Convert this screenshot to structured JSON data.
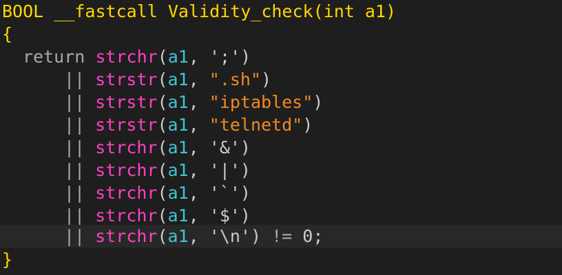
{
  "code": {
    "signature": {
      "return_type": "BOOL",
      "calling_convention": "__fastcall",
      "function_name": "Validity_check",
      "open_paren": "(",
      "param_type": "int",
      "param_name": "a1",
      "close_paren": ")"
    },
    "open_brace": "{",
    "close_brace": "}",
    "return_keyword": "return",
    "or_operator": "||",
    "calls": [
      {
        "fn": "strchr",
        "arg": "a1",
        "literal": "';'"
      },
      {
        "fn": "strstr",
        "arg": "a1",
        "literal": "\".sh\""
      },
      {
        "fn": "strstr",
        "arg": "a1",
        "literal": "\"iptables\""
      },
      {
        "fn": "strstr",
        "arg": "a1",
        "literal": "\"telnetd\""
      },
      {
        "fn": "strchr",
        "arg": "a1",
        "literal": "'&'"
      },
      {
        "fn": "strchr",
        "arg": "a1",
        "literal": "'|'"
      },
      {
        "fn": "strchr",
        "arg": "a1",
        "literal": "'`'"
      },
      {
        "fn": "strchr",
        "arg": "a1",
        "literal": "'$'"
      },
      {
        "fn": "strchr",
        "arg": "a1",
        "literal": "'\\n'"
      }
    ],
    "final_comparison": "!=",
    "final_value": "0",
    "terminator": ";"
  },
  "colors": {
    "background": "#1e1e1e",
    "current_line": "#282828",
    "signature": "#ffd700",
    "function": "#ff41c0",
    "variable": "#3ec6d0",
    "double_string": "#f08a24",
    "keyword": "#aaaaaa"
  }
}
